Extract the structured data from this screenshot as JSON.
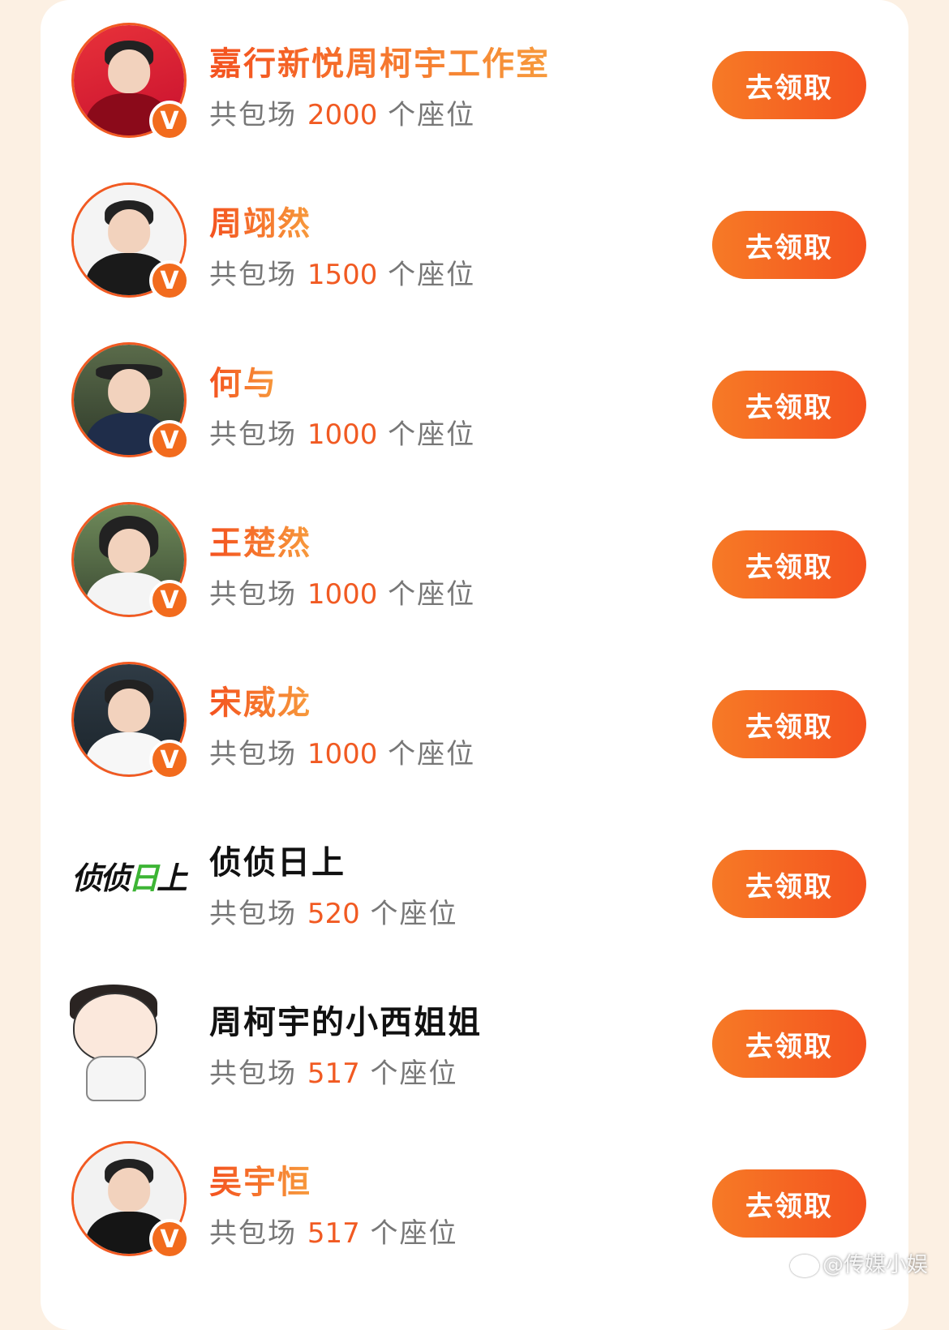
{
  "seat_prefix": "共包场",
  "seat_suffix": "个座位",
  "button_label": "去领取",
  "verified_mark": "V",
  "accent_color": "#f15a22",
  "items": [
    {
      "name": "嘉行新悦周柯宇工作室",
      "seats": "2000",
      "verified": true
    },
    {
      "name": "周翊然",
      "seats": "1500",
      "verified": true
    },
    {
      "name": "何与",
      "seats": "1000",
      "verified": true
    },
    {
      "name": "王楚然",
      "seats": "1000",
      "verified": true
    },
    {
      "name": "宋威龙",
      "seats": "1000",
      "verified": true
    },
    {
      "name": "侦侦日上",
      "seats": "520",
      "verified": false,
      "logo_text": "侦侦日上"
    },
    {
      "name": "周柯宇的小西姐姐",
      "seats": "517",
      "verified": false
    },
    {
      "name": "吴宇恒",
      "seats": "517",
      "verified": true
    }
  ],
  "watermark": "@传媒小娱"
}
